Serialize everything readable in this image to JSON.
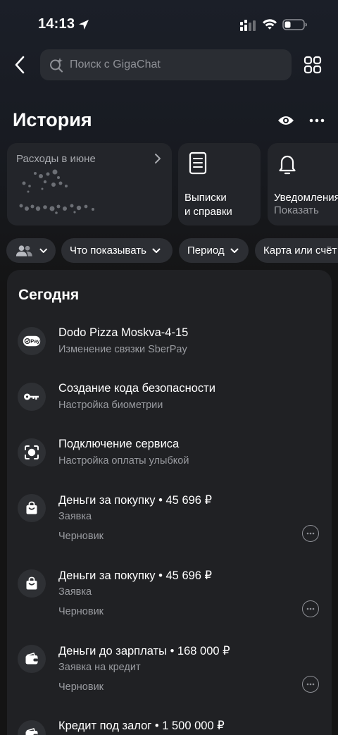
{
  "status_bar": {
    "time": "14:13"
  },
  "search": {
    "placeholder": "Поиск с GigaChat"
  },
  "header": {
    "title": "История"
  },
  "cards": {
    "expenses": {
      "label": "Расходы в июне"
    },
    "statements": {
      "title_line1": "Выписки",
      "title_line2": "и справки"
    },
    "notifications": {
      "title": "Уведомления",
      "subtitle": "Показать"
    }
  },
  "filters": {
    "what": "Что показывать",
    "period": "Период",
    "card": "Карта или счёт"
  },
  "history": {
    "section_title": "Сегодня",
    "items": [
      {
        "title": "Dodo Pizza Moskva-4-15",
        "subtitle": "Изменение связки SberPay",
        "icon": "sberpay-icon"
      },
      {
        "title": "Создание кода безопасности",
        "subtitle": "Настройка биометрии",
        "icon": "key-icon"
      },
      {
        "title": "Подключение сервиса",
        "subtitle": "Настройка оплаты улыбкой",
        "icon": "face-scan-icon"
      },
      {
        "title": "Деньги за покупку • 45 696 ₽",
        "subtitle": "Заявка",
        "status": "Черновик",
        "icon": "shopping-bag-icon"
      },
      {
        "title": "Деньги за покупку • 45 696 ₽",
        "subtitle": "Заявка",
        "status": "Черновик",
        "icon": "shopping-bag-icon"
      },
      {
        "title": "Деньги до зарплаты • 168 000 ₽",
        "subtitle": "Заявка на кредит",
        "status": "Черновик",
        "icon": "wallet-icon"
      },
      {
        "title": "Кредит под залог • 1 500 000 ₽",
        "icon": "wallet-icon"
      }
    ]
  },
  "colors": {
    "background": "#141414",
    "panel": "#202124",
    "card": "#23252a",
    "chip": "#2c2e33",
    "secondary_text": "#9a9ca1"
  }
}
